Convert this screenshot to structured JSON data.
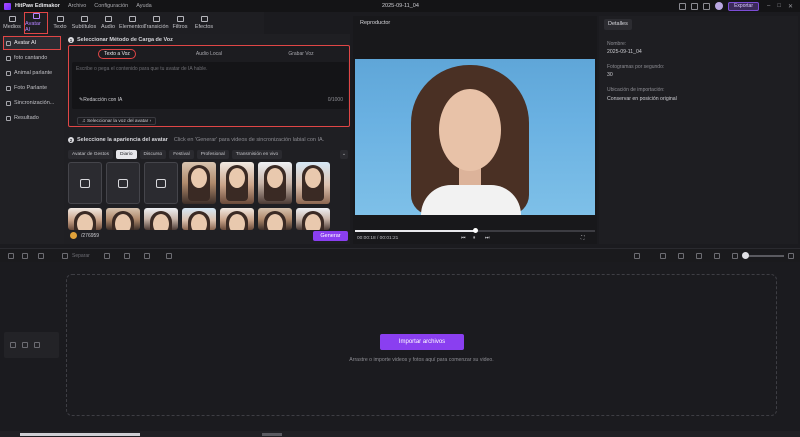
{
  "app": {
    "name": "HitPaw Edimakor",
    "menu": [
      "Archivo",
      "Configuración",
      "Ayuda"
    ],
    "doc_title": "2025-09-11_04",
    "export_label": "Exportar"
  },
  "tabs": [
    {
      "label": "Medios"
    },
    {
      "label": "Avatar AI"
    },
    {
      "label": "Texto"
    },
    {
      "label": "Subtítulos"
    },
    {
      "label": "Audio"
    },
    {
      "label": "Elementos"
    },
    {
      "label": "Transición"
    },
    {
      "label": "Filtros"
    },
    {
      "label": "Efectos"
    }
  ],
  "sidebar": {
    "items": [
      {
        "label": "Avatar AI"
      },
      {
        "label": "foto cantando"
      },
      {
        "label": "Animal parlante"
      },
      {
        "label": "Foto Parlante"
      },
      {
        "label": "Sincronización..."
      },
      {
        "label": "Resultado"
      }
    ]
  },
  "voice": {
    "section_title": "Seleccionar Método de Carga de Voz",
    "tabs": [
      "Texto a Voz",
      "Audio Local",
      "Grabar Voz"
    ],
    "placeholder": "Escribe o pega el contenido para que tu avatar de IA hable.",
    "ai_write": "Redacción con IA",
    "counter": "0/1000",
    "select_voice": "Seleccionar la voz del avatar"
  },
  "look": {
    "section_title": "Seleccione la apariencia del avatar",
    "hint": "Click en 'Generar' para videos de sincronización labial con IA.",
    "chips": [
      "Avatar de Gestos",
      "Diario",
      "Discurso",
      "Festival",
      "Profesional",
      "Transmisión en vivo"
    ],
    "credits": "/276959",
    "generate_label": "Generar"
  },
  "player": {
    "title": "Reproductor",
    "timecode": "00:00:18 / 00:01:21",
    "progress": 0.5
  },
  "details": {
    "tab": "Detalles",
    "name_label": "Nombre:",
    "name_value": "2025-09-11_04",
    "fps_label": "Fotogramas por segundo:",
    "fps_value": "30",
    "import_label": "Ubicación de importación:",
    "import_value": "Conservar en posición original"
  },
  "timeline": {
    "separate_label": "Separar",
    "import_button": "Importar archivos",
    "drop_hint": "Arrastre o importe videos y fotos aquí para comenzar su video."
  }
}
